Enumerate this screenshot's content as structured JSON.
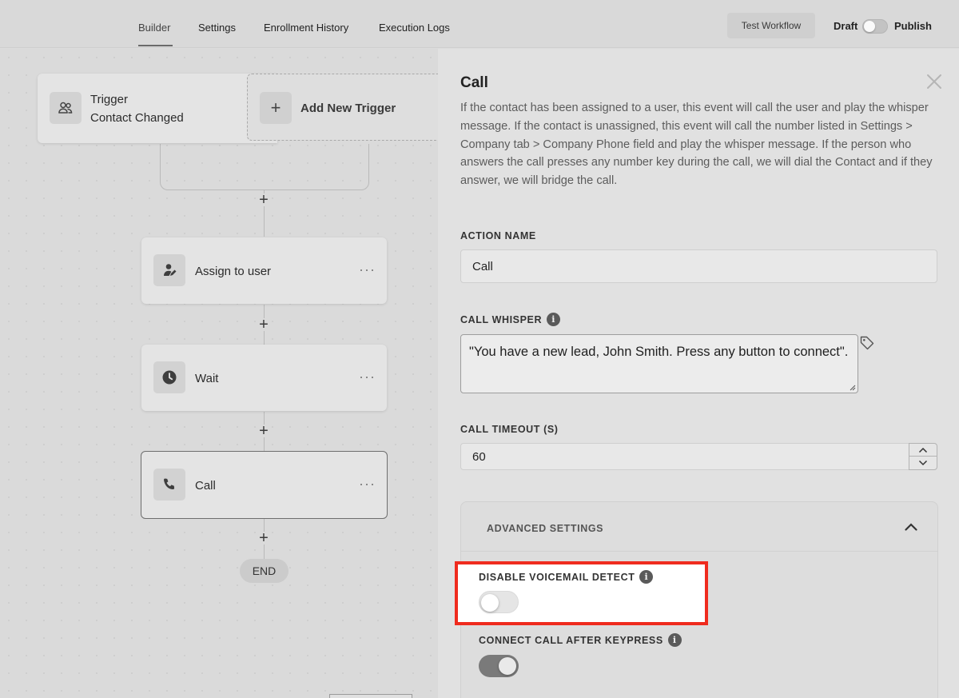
{
  "topbar": {
    "tabs": [
      {
        "label": "Builder"
      },
      {
        "label": "Settings"
      },
      {
        "label": "Enrollment History"
      },
      {
        "label": "Execution Logs"
      }
    ],
    "test_label": "Test Workflow",
    "draft_label": "Draft",
    "publish_label": "Publish"
  },
  "canvas": {
    "trigger": {
      "title": "Trigger",
      "subtitle": "Contact Changed"
    },
    "add_trigger": "Add New Trigger",
    "steps": [
      {
        "label": "Assign to user",
        "icon": "user-assign-icon"
      },
      {
        "label": "Wait",
        "icon": "clock-icon"
      },
      {
        "label": "Call",
        "icon": "phone-icon"
      }
    ],
    "dots": "···",
    "plus": "+",
    "end_label": "END"
  },
  "panel": {
    "title": "Call",
    "description": "If the contact has been assigned to a user, this event will call the user and play the whisper message. If the contact is unassigned, this event will call the number listed in Settings > Company tab > Company Phone field and play the whisper message. If the person who answers the call presses any number key during the call, we will dial the Contact and if they answer, we will bridge the call.",
    "action_name_label": "ACTION NAME",
    "action_name_value": "Call",
    "whisper_label": "CALL WHISPER",
    "whisper_value": "\"You have a new lead, John Smith. Press any button to connect\".",
    "timeout_label": "CALL TIMEOUT (S)",
    "timeout_value": "60",
    "advanced_label": "ADVANCED SETTINGS",
    "voicemail_label": "DISABLE VOICEMAIL DETECT",
    "voicemail_enabled": false,
    "keypress_label": "CONNECT CALL AFTER KEYPRESS",
    "keypress_enabled": true,
    "info_glyph": "i"
  },
  "colors": {
    "highlight_border": "#ef2b1e"
  }
}
